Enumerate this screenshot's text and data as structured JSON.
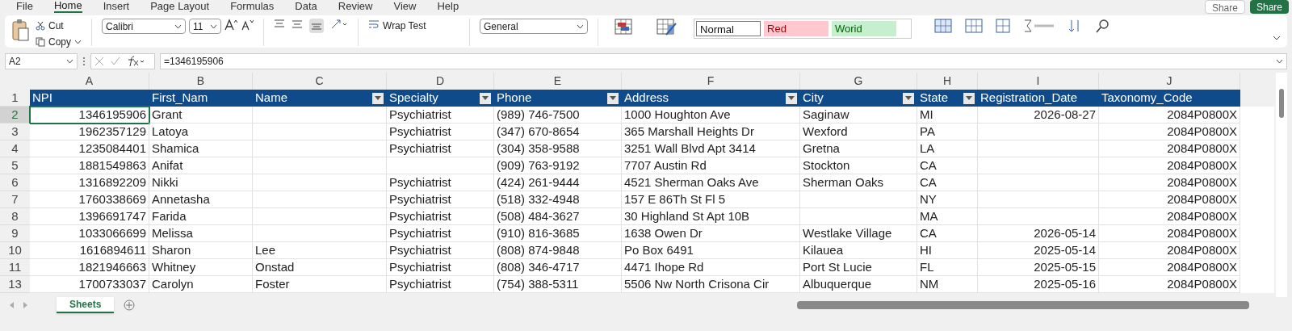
{
  "menu_tabs": [
    {
      "label": "File",
      "selected": false
    },
    {
      "label": "Home",
      "selected": true
    },
    {
      "label": "Insert",
      "selected": false
    },
    {
      "label": "Page Layout",
      "selected": false
    },
    {
      "label": "Formulas",
      "selected": false
    },
    {
      "label": "Data",
      "selected": false
    },
    {
      "label": "Review",
      "selected": false
    },
    {
      "label": "View",
      "selected": false
    },
    {
      "label": "Help",
      "selected": false
    }
  ],
  "share_buttons": [
    {
      "label": "Share",
      "kind": "outline"
    },
    {
      "label": "Share",
      "kind": "primary"
    }
  ],
  "clipboard": {
    "cut": "Cut",
    "copy": "Copy"
  },
  "font": {
    "name": "Calibri",
    "size": "11"
  },
  "wrap_text": "Wrap Test",
  "number_format": "General",
  "styles": [
    {
      "label": "Normal",
      "kind": "normal"
    },
    {
      "label": "Red",
      "kind": "bad"
    },
    {
      "label": "Worid",
      "kind": "good"
    }
  ],
  "name_box": "A2",
  "formula": "=1346195906",
  "columns": [
    "A",
    "B",
    "C",
    "D",
    "E",
    "F",
    "G",
    "H",
    "I",
    "J"
  ],
  "header": {
    "number": "1",
    "cells": [
      {
        "text": "NPI",
        "filter": false
      },
      {
        "text": "First_Nam",
        "filter": false
      },
      {
        "text": "Name",
        "filter": true
      },
      {
        "text": "Specialty",
        "filter": true
      },
      {
        "text": "Phone",
        "filter": true
      },
      {
        "text": "Address",
        "filter": true
      },
      {
        "text": "City",
        "filter": true
      },
      {
        "text": "State",
        "filter": true
      },
      {
        "text": "Registration_Date",
        "filter": false
      },
      {
        "text": "Taxonomy_Code",
        "filter": false
      }
    ]
  },
  "rows": [
    {
      "number": "2",
      "active": true,
      "cells": {
        "A": "1346195906",
        "B": "Grant",
        "D": "Psychiatrist",
        "E": "(989) 746-7500",
        "F": "1000 Houghton Ave",
        "G": "Saginaw",
        "H": "MI",
        "I": "2026-08-27",
        "J": "2084P0800X"
      }
    },
    {
      "number": "3",
      "active": false,
      "cells": {
        "A": "1962357129",
        "B": "Latoya",
        "D": "Psychiatrist",
        "E": "(347) 670-8654",
        "F": "365 Marshall Heights Dr",
        "G": "Wexford",
        "H": "PA",
        "J": "2084P0800X"
      }
    },
    {
      "number": "4",
      "active": false,
      "cells": {
        "A": "1235084401",
        "B": "Shamica",
        "D": "Psychiatrist",
        "E": "(304) 358-9588",
        "F": "3251 Wall Blvd Apt 3414",
        "G": "Gretna",
        "H": "LA",
        "J": "2084P0800X"
      }
    },
    {
      "number": "5",
      "active": false,
      "cells": {
        "A": "1881549863",
        "B": "Anifat",
        "E": "(909) 763-9192",
        "F": "7707 Austin Rd",
        "G": "Stockton",
        "H": "CA",
        "J": "2084P0800X"
      }
    },
    {
      "number": "6",
      "active": false,
      "cells": {
        "A": "1316892209",
        "B": "Nikki",
        "D": "Psychiatrist",
        "E": "(424) 261-9444",
        "F": "4521 Sherman Oaks Ave",
        "G": "Sherman Oaks",
        "H": "CA",
        "J": "2084P0800X"
      }
    },
    {
      "number": "7",
      "active": false,
      "cells": {
        "A": "1760338669",
        "B": "Annetasha",
        "D": "Psychiatrist",
        "E": "(518) 332-4948",
        "F": "157 E 86Th St Fl 5",
        "H": "NY",
        "J": "2084P0800X"
      }
    },
    {
      "number": "8",
      "active": false,
      "cells": {
        "A": "1396691747",
        "B": "Farida",
        "D": "Psychiatrist",
        "E": "(508) 484-3627",
        "F": "30 Highland St Apt 10B",
        "H": "MA",
        "J": "2084P0800X"
      }
    },
    {
      "number": "9",
      "active": false,
      "cells": {
        "A": "1033066699",
        "B": "Melissa",
        "D": "Psychiatrist",
        "E": "(910) 816-3685",
        "F": "1638 Owen Dr",
        "G": "Westlake Village",
        "H": "CA",
        "I": "2026-05-14",
        "J": "2084P0800X"
      }
    },
    {
      "number": "10",
      "active": false,
      "cells": {
        "A": "1616894611",
        "B": "Sharon",
        "C": "Lee",
        "D": "Psychiatrist",
        "E": "(808) 874-9848",
        "F": "Po Box 6491",
        "G": "Kilauea",
        "H": "HI",
        "I": "2025-05-14",
        "J": "2084P0800X"
      }
    },
    {
      "number": "11",
      "active": false,
      "cells": {
        "A": "1821946663",
        "B": "Whitney",
        "C": "Onstad",
        "D": "Psychiatrist",
        "E": "(808) 346-4717",
        "F": "4471 Ihope Rd",
        "G": "Port St Lucie",
        "H": "FL",
        "I": "2025-05-15",
        "J": "2084P0800X"
      }
    },
    {
      "number": "13",
      "active": false,
      "cells": {
        "A": "1700733037",
        "B": "Carolyn",
        "C": "Foster",
        "D": "Psychiatrist",
        "E": "(754) 388-5311",
        "F": "5506 Nw North Crisona Cir",
        "G": "Albuquerque",
        "H": "NM",
        "I": "2025-05-16",
        "J": "2084P0800X"
      }
    }
  ],
  "sheet_tabs": [
    {
      "label": "Sheets",
      "selected": true
    }
  ]
}
